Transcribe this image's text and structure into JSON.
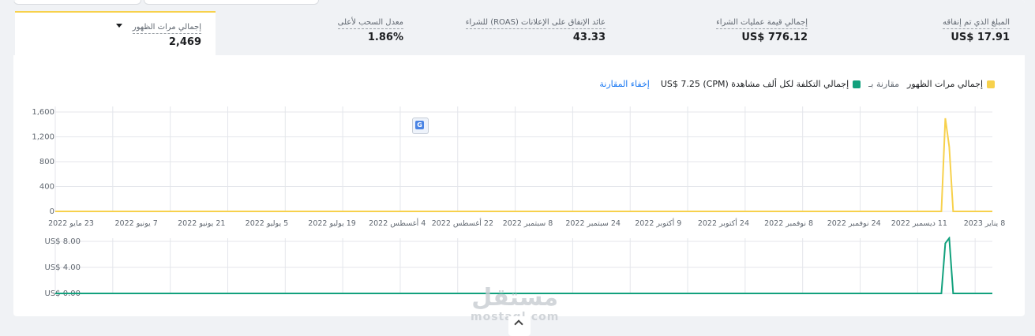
{
  "metrics": [
    {
      "label": "المبلغ الذي تم إنفاقه",
      "value": "US$ 17.91"
    },
    {
      "label": "إجمالي قيمة عمليات الشراء",
      "value": "US$ 776.12"
    },
    {
      "label": "عائد الإنفاق على الإعلانات (ROAS) للشراء",
      "value": "43.33"
    },
    {
      "label": "معدل السحب لأعلى",
      "value": "1.86%"
    }
  ],
  "active_metric": {
    "label": "إجمالي مرات الظهور",
    "value": "2,469"
  },
  "legend": {
    "series1": "إجمالي مرات الظهور",
    "compare": "مقارنة بـ",
    "series2": "إجمالي التكلفة لكل ألف مشاهدة (CPM) US$ 7.25",
    "hide": "إخفاء المقارنة"
  },
  "colors": {
    "series1": "#f7d14c",
    "series2": "#12a17d",
    "grid": "#e4e6eb",
    "axis_text": "#606770"
  },
  "icon": "translate-icon",
  "watermark": {
    "line1": "مستقل",
    "line2": "mostaql.com"
  },
  "chart_data": [
    {
      "type": "line",
      "series": [
        {
          "name": "إجمالي مرات الظهور",
          "color": "#f7d14c"
        }
      ],
      "yticks": [
        "0",
        "400",
        "800",
        "1,200",
        "1,600"
      ],
      "ylim": [
        0,
        1600
      ],
      "xticks": [
        "23 مايو 2022",
        "7 يونيو 2022",
        "21 يونيو 2022",
        "5 يوليو 2022",
        "19 يوليو 2022",
        "4 أغسطس 2022",
        "22 أغسطس 2022",
        "8 سبتمبر 2022",
        "24 سبتمبر 2022",
        "9 أكتوبر 2022",
        "24 أكتوبر 2022",
        "8 نوفمبر 2022",
        "24 نوفمبر 2022",
        "11 ديسمبر 2022",
        "8 يناير 2023"
      ],
      "x": [
        "2022-05-23",
        "2023-01-04",
        "2023-01-05",
        "2023-01-06",
        "2023-01-07",
        "2023-01-08",
        "2023-01-17"
      ],
      "values": [
        0,
        0,
        1500,
        1040,
        0,
        0,
        0
      ]
    },
    {
      "type": "line",
      "series": [
        {
          "name": "إجمالي التكلفة لكل ألف مشاهدة (CPM)",
          "color": "#12a17d"
        }
      ],
      "yticks": [
        "US$ 0.00",
        "US$ 4.00",
        "US$ 8.00"
      ],
      "ylim": [
        0,
        8
      ],
      "x": [
        "2022-05-23",
        "2023-01-04",
        "2023-01-05",
        "2023-01-06",
        "2023-01-07",
        "2023-01-08",
        "2023-01-17"
      ],
      "values": [
        0,
        0,
        7.7,
        8.5,
        0,
        0,
        0
      ]
    }
  ]
}
